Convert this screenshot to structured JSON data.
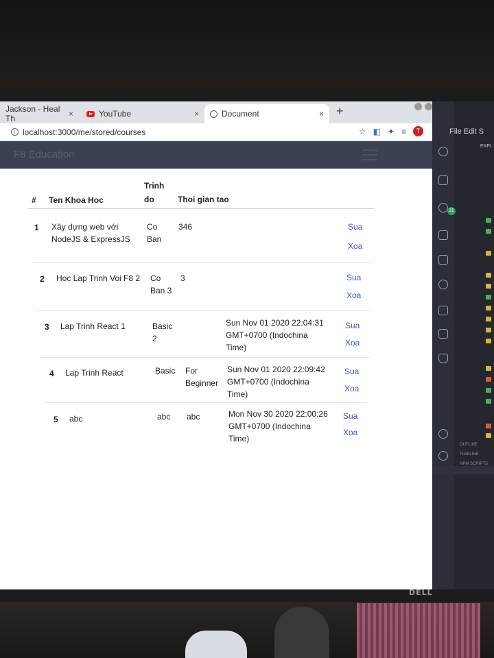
{
  "browser": {
    "tabs": [
      {
        "label": "Jackson - Heal Th",
        "active": false
      },
      {
        "label": "YouTube",
        "active": false
      },
      {
        "label": "Document",
        "active": true
      }
    ],
    "tab_close": "×",
    "new_tab": "+",
    "url": "localhost:3000/me/stored/courses",
    "profile_initial": "T"
  },
  "navbar": {
    "brand": "F8 Education"
  },
  "table": {
    "headers": {
      "index": "#",
      "name": "Ten Khoa Hoc",
      "level_line1": "Trinh",
      "level_line2": "do",
      "created": "Thoi gian tao"
    },
    "rows": [
      {
        "index": "1",
        "name": "Xây dựng web với NodeJS & ExpressJS",
        "level": "Co Ban",
        "time": "346",
        "edit": "Sua",
        "delete": "Xoa"
      },
      {
        "index": "2",
        "name": "Hoc Lap Trinh Voi F8 2",
        "level": "Co Ban 3",
        "time": "3",
        "edit": "Sua",
        "delete": "Xoa"
      },
      {
        "index": "3",
        "name": "Lap Trinh React 1",
        "level": "Basic 2",
        "time": "Sun Nov 01 2020 22:04:31 GMT+0700 (Indochina Time)",
        "edit": "Sua",
        "delete": "Xoa"
      },
      {
        "index": "4",
        "name": "Lap Trinh React",
        "level": "Basic",
        "extra": "For Beginner",
        "time": "Sun Nov 01 2020 22:09:42 GMT+0700 (Indochina Time)",
        "edit": "Sua",
        "delete": "Xoa"
      },
      {
        "index": "5",
        "name": "abc",
        "level": "abc",
        "extra": "abc",
        "time": "Mon Nov 30 2020 22:00:26 GMT+0700 (Indochina Time)",
        "edit": "Sua",
        "delete": "Xoa"
      }
    ]
  },
  "vscode": {
    "menu": "File Edit S",
    "explorer_title": "EXPL",
    "badge": "31",
    "panel_labels": [
      "OUTLINE",
      "TIMELINE",
      "NPM SCRIPTS"
    ]
  },
  "monitor": {
    "brand": "DELL"
  },
  "colors": {
    "link": "#3a55c8",
    "navbar": "#3b4150",
    "tabstrip": "#dee1e6"
  }
}
